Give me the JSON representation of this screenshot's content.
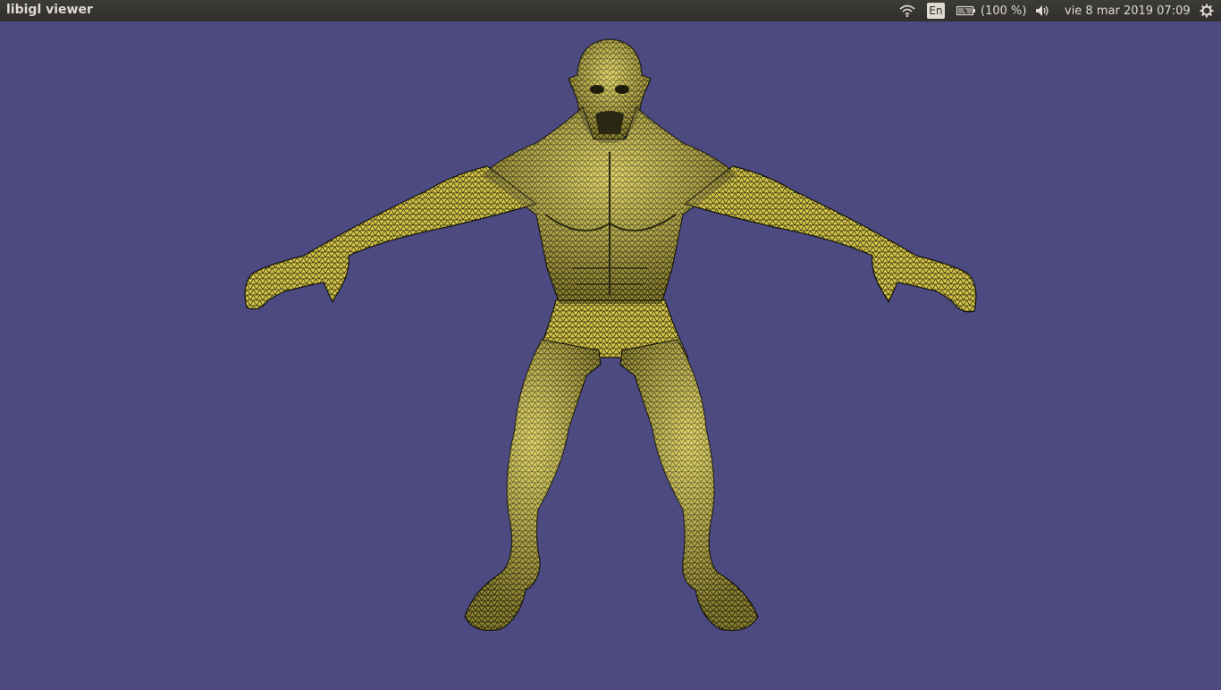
{
  "window": {
    "title": "libigl viewer"
  },
  "indicators": {
    "wifi_icon": "wifi-icon",
    "language": "En",
    "battery_icon": "battery-icon",
    "battery_percent": "(100 %)",
    "volume_icon": "volume-icon",
    "datetime": "vie  8 mar 2019 07:09",
    "settings_icon": "gear-icon"
  },
  "colors": {
    "viewport_background": "#4c4a80",
    "mesh_fill": "#d9c84a",
    "mesh_wire": "#1a1a10",
    "topbar": "#34332f"
  }
}
